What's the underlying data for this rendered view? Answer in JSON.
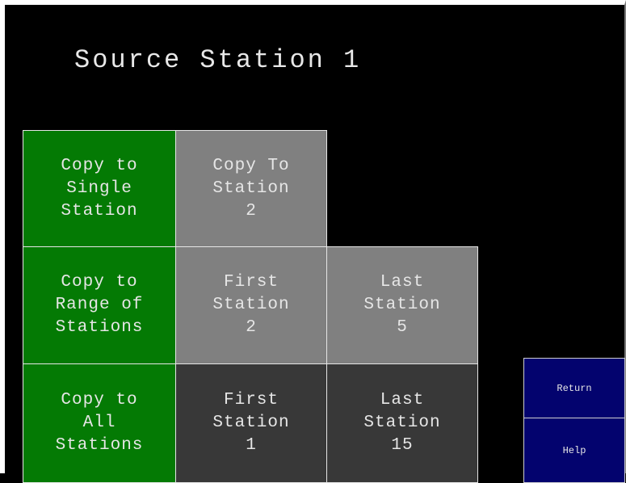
{
  "screen": {
    "title": "Source Station 1"
  },
  "rows": [
    {
      "mode": [
        "Copy to",
        "Single",
        "Station"
      ],
      "cells": [
        [
          "Copy To",
          "Station",
          "2"
        ]
      ]
    },
    {
      "mode": [
        "Copy to",
        "Range of",
        "Stations"
      ],
      "cells": [
        [
          "First",
          "Station",
          "2"
        ],
        [
          "Last",
          "Station",
          "5"
        ]
      ]
    },
    {
      "mode": [
        "Copy to",
        "All",
        "Stations"
      ],
      "cells": [
        [
          "First",
          "Station",
          "1"
        ],
        [
          "Last",
          "Station",
          "15"
        ]
      ]
    }
  ],
  "buttons": {
    "return_label": "Return",
    "help_label": "Help"
  },
  "colors": {
    "background": "#000000",
    "mode_button": "#047a04",
    "editable_field": "#808080",
    "readonly_field": "#383838",
    "nav_button": "#03036e",
    "text": "#e6e6e6"
  }
}
